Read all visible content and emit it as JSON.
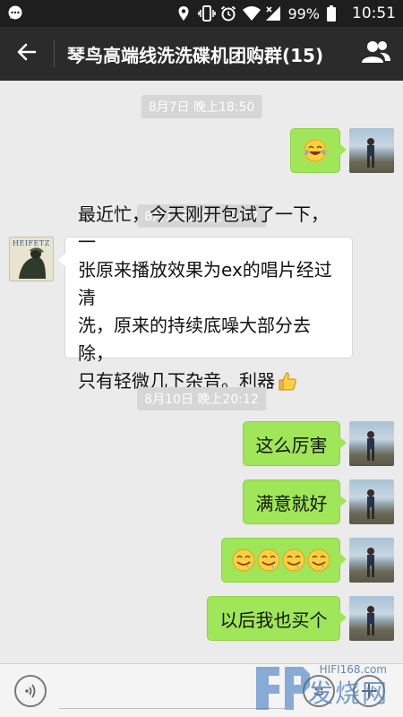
{
  "status_bar": {
    "battery": "99%",
    "time": "10:51",
    "icons": [
      "chat-notification-icon",
      "location-icon",
      "vibrate-icon",
      "alarm-icon",
      "wifi-icon",
      "signal-icon",
      "battery-icon"
    ]
  },
  "header": {
    "title": "琴鸟高端线洗洗碟机团购群(15)",
    "back_icon": "back-arrow-icon",
    "group_icon": "group-members-icon"
  },
  "messages": [
    {
      "type": "time",
      "text": "8月7日 晚上18:50"
    },
    {
      "type": "msg",
      "side": "me",
      "content": "emoji",
      "emoji": [
        "tears-of-joy"
      ]
    },
    {
      "type": "time",
      "text": "8月10日 晚上19:12"
    },
    {
      "type": "msg",
      "side": "other",
      "avatar_text": "HEIFETZ",
      "lines": [
        "最近忙，今天刚开包试了一下，一",
        "张原来播放效果为ex的唱片经过清",
        "洗，原来的持续底噪大部分去除，",
        "只有轻微几下杂音。利器"
      ],
      "trailing_emoji": "thumbs-up"
    },
    {
      "type": "time",
      "text": "8月10日 晚上20:12"
    },
    {
      "type": "msg",
      "side": "me",
      "text": "这么厉害"
    },
    {
      "type": "msg",
      "side": "me",
      "text": "满意就好"
    },
    {
      "type": "msg",
      "side": "me",
      "content": "emoji",
      "emoji": [
        "drooling",
        "drooling",
        "drooling",
        "drooling"
      ]
    },
    {
      "type": "msg",
      "side": "me",
      "text": "以后我也买个"
    }
  ],
  "input_bar": {
    "voice_icon": "voice-icon",
    "emoji_icon": "emoji-icon",
    "plus_icon": "plus-icon",
    "placeholder": ""
  },
  "watermark": {
    "url": "HIFI168.com",
    "text": "发烧网"
  },
  "colors": {
    "statusbar": "#1e1e1e",
    "titlebar": "#2b2b2b",
    "chat_bg": "#ebebeb",
    "my_bubble": "#9fe658",
    "other_bubble": "#ffffff",
    "time_pill": "#d6d6d6"
  }
}
